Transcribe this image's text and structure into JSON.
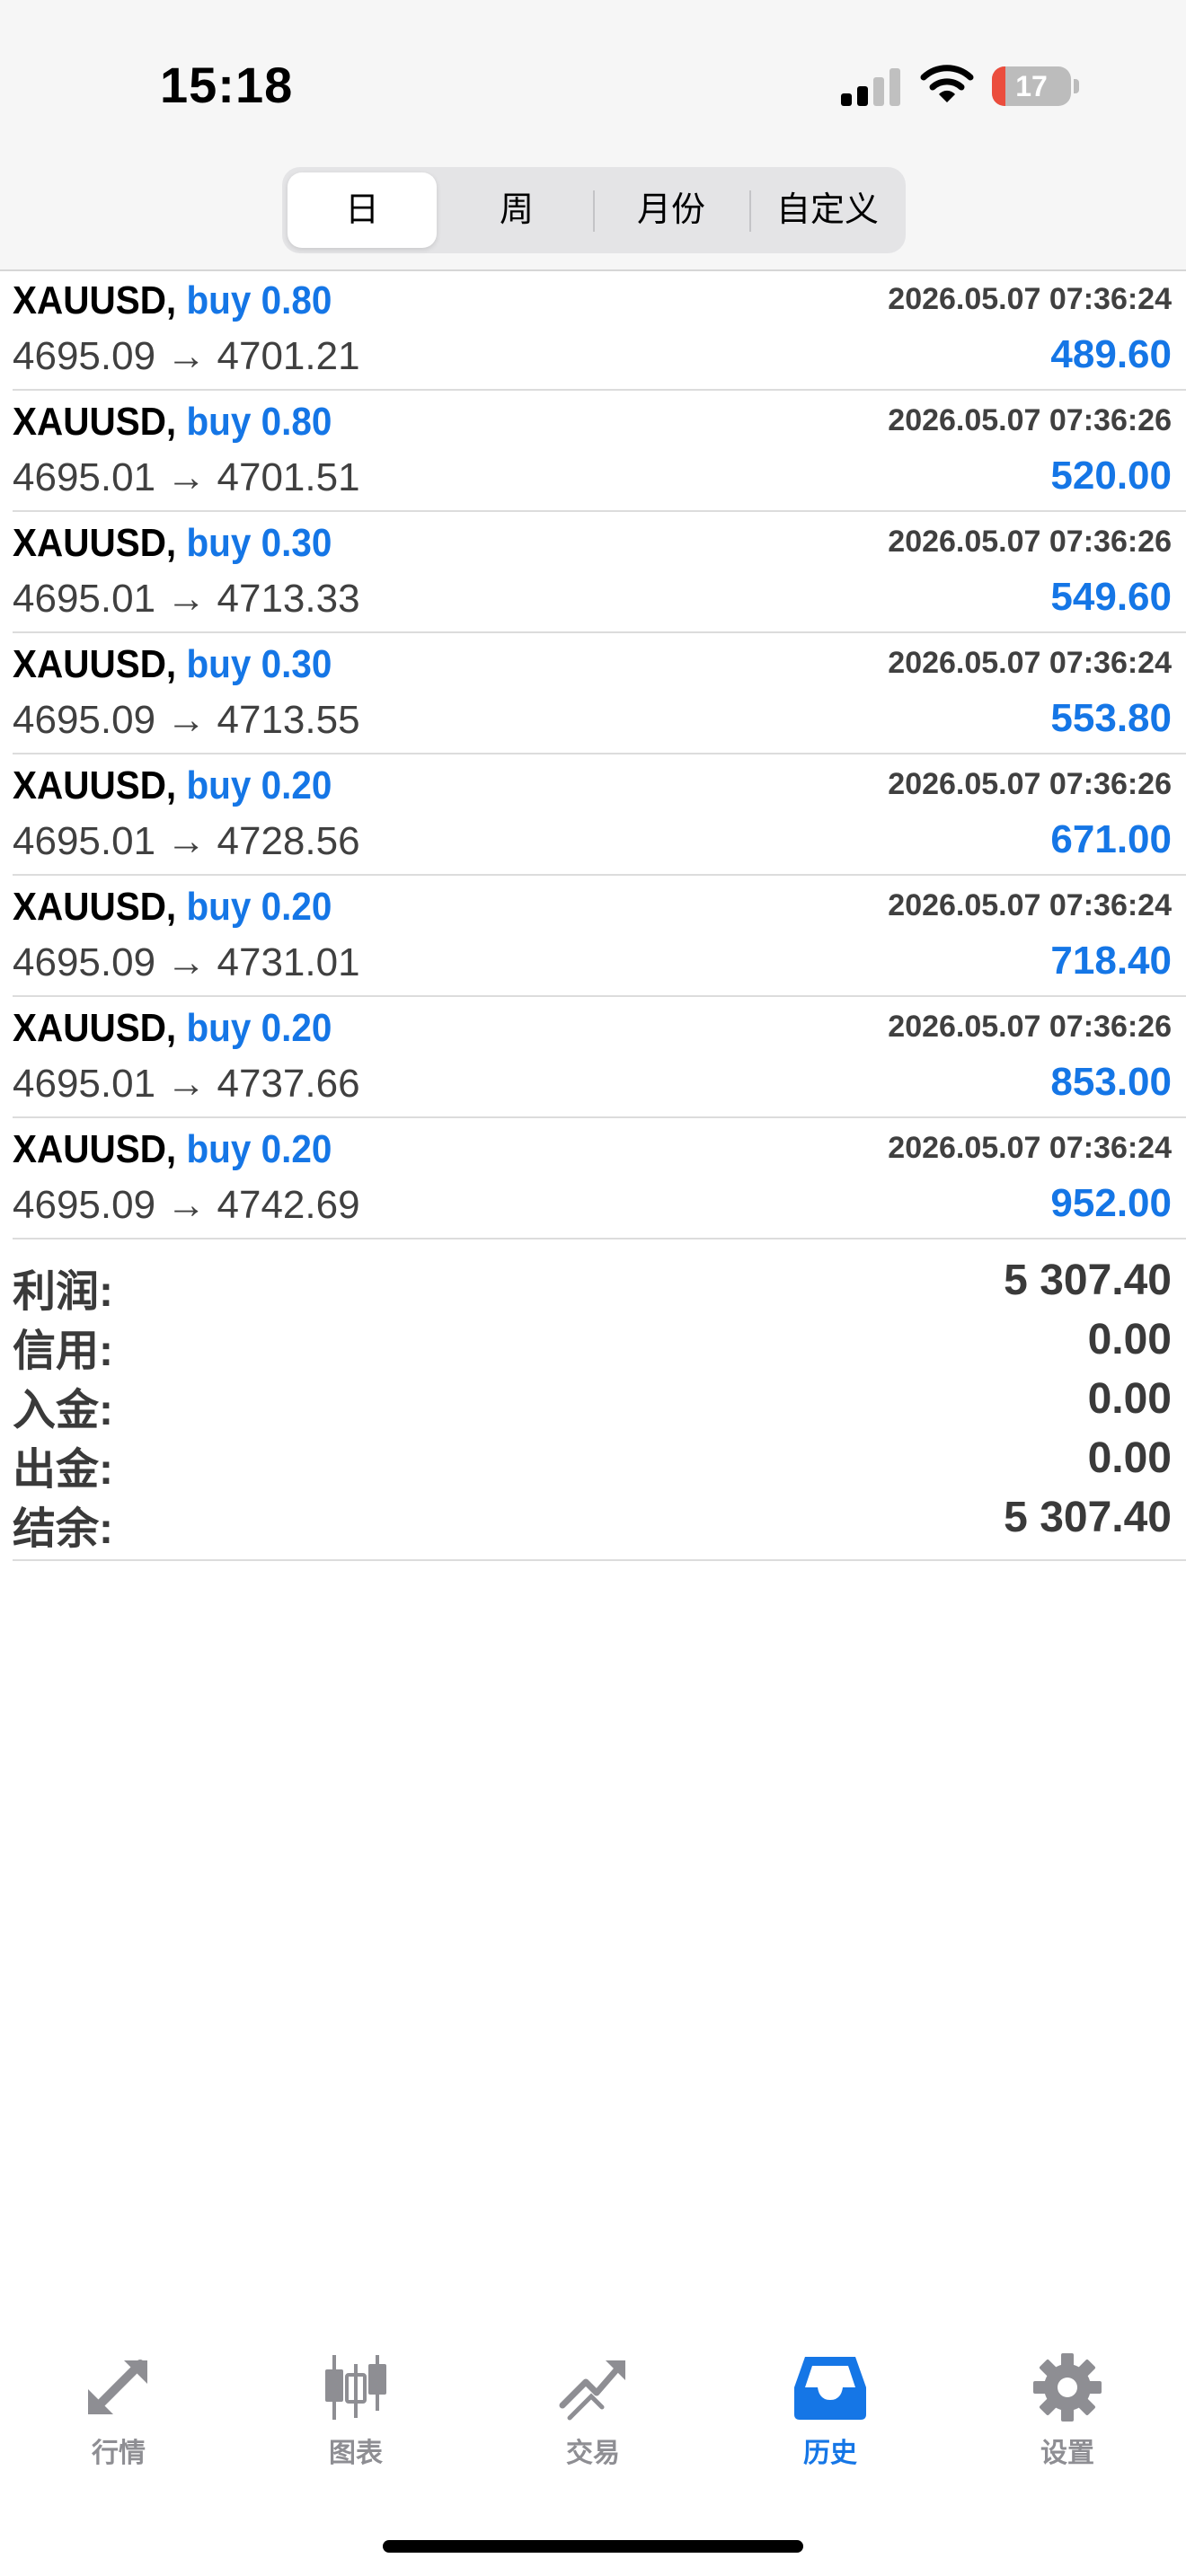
{
  "status_bar": {
    "time": "15:18",
    "battery": "17",
    "battery_level_percent": 17
  },
  "period_tabs": [
    {
      "label": "日",
      "active": true
    },
    {
      "label": "周",
      "active": false
    },
    {
      "label": "月份",
      "active": false
    },
    {
      "label": "自定义",
      "active": false
    }
  ],
  "deals": [
    {
      "symbol": "XAUUSD,",
      "side": "buy 0.80",
      "date": "2026.05.07 07:36:24",
      "prices": "4695.09 → 4701.21",
      "profit": "489.60"
    },
    {
      "symbol": "XAUUSD,",
      "side": "buy 0.80",
      "date": "2026.05.07 07:36:26",
      "prices": "4695.01 → 4701.51",
      "profit": "520.00"
    },
    {
      "symbol": "XAUUSD,",
      "side": "buy 0.30",
      "date": "2026.05.07 07:36:26",
      "prices": "4695.01 → 4713.33",
      "profit": "549.60"
    },
    {
      "symbol": "XAUUSD,",
      "side": "buy 0.30",
      "date": "2026.05.07 07:36:24",
      "prices": "4695.09 → 4713.55",
      "profit": "553.80"
    },
    {
      "symbol": "XAUUSD,",
      "side": "buy 0.20",
      "date": "2026.05.07 07:36:26",
      "prices": "4695.01 → 4728.56",
      "profit": "671.00"
    },
    {
      "symbol": "XAUUSD,",
      "side": "buy 0.20",
      "date": "2026.05.07 07:36:24",
      "prices": "4695.09 → 4731.01",
      "profit": "718.40"
    },
    {
      "symbol": "XAUUSD,",
      "side": "buy 0.20",
      "date": "2026.05.07 07:36:26",
      "prices": "4695.01 → 4737.66",
      "profit": "853.00"
    },
    {
      "symbol": "XAUUSD,",
      "side": "buy 0.20",
      "date": "2026.05.07 07:36:24",
      "prices": "4695.09 → 4742.69",
      "profit": "952.00"
    }
  ],
  "summary": [
    {
      "label": "利润:",
      "value": "5 307.40"
    },
    {
      "label": "信用:",
      "value": "0.00"
    },
    {
      "label": "入金:",
      "value": "0.00"
    },
    {
      "label": "出金:",
      "value": "0.00"
    },
    {
      "label": "结余:",
      "value": "5 307.40"
    }
  ],
  "tabbar": [
    {
      "label": "行情",
      "icon": "quotes-arrows-icon",
      "active": false
    },
    {
      "label": "图表",
      "icon": "candlestick-chart-icon",
      "active": false
    },
    {
      "label": "交易",
      "icon": "trade-trend-icon",
      "active": false
    },
    {
      "label": "历史",
      "icon": "history-inbox-icon",
      "active": true
    },
    {
      "label": "设置",
      "icon": "gear-icon",
      "active": false
    }
  ],
  "colors": {
    "accent": "#1576e6",
    "text_secondary": "#404040",
    "tab_inactive": "#8e8e93",
    "battery_low": "#eb4d3d"
  }
}
